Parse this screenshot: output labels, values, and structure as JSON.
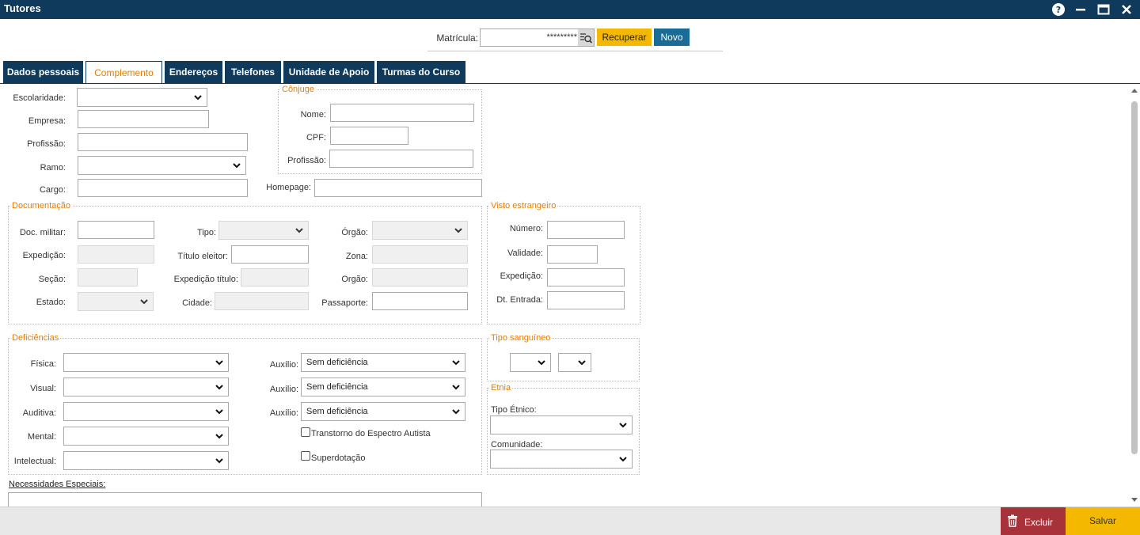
{
  "window": {
    "title": "Tutores"
  },
  "header": {
    "matricula_label": "Matrícula:",
    "matricula_value": "*********",
    "recuperar_label": "Recuperar",
    "novo_label": "Novo"
  },
  "tabs": [
    "Dados pessoais",
    "Complemento",
    "Endereços",
    "Telefones",
    "Unidade de Apoio",
    "Turmas do Curso"
  ],
  "active_tab": "Complemento",
  "form": {
    "escolaridade": "Escolaridade:",
    "empresa": "Empresa:",
    "profissao": "Profissão:",
    "ramo": "Ramo:",
    "cargo": "Cargo:",
    "homepage": "Homepage:"
  },
  "conjuge": {
    "legend": "Cônjuge",
    "nome": "Nome:",
    "cpf": "CPF:",
    "profissao": "Profissão:"
  },
  "documentacao": {
    "legend": "Documentação",
    "doc_militar": "Doc. militar:",
    "expedicao": "Expedição:",
    "secao": "Seção:",
    "estado": "Estado:",
    "tipo": "Tipo:",
    "titulo_eleitor": "Título eleitor:",
    "expedicao_titulo": "Expedição título:",
    "cidade": "Cidade:",
    "orgao": "Órgão:",
    "zona": "Zona:",
    "orgao2": "Orgão:",
    "passaporte": "Passaporte:"
  },
  "visto": {
    "legend": "Visto estrangeiro",
    "numero": "Número:",
    "validade": "Validade:",
    "expedicao": "Expedição:",
    "dt_entrada": "Dt. Entrada:"
  },
  "deficiencias": {
    "legend": "Deficiências",
    "fisica": "Física:",
    "visual": "Visual:",
    "auditiva": "Auditiva:",
    "mental": "Mental:",
    "intelectual": "Intelectual:",
    "auxilio": "Auxílio:",
    "auxilio_value": "Sem deficiência",
    "tea": "Transtorno do Espectro Autista",
    "superdotacao": "Superdotação"
  },
  "tipo_sanguineo": {
    "legend": "Tipo sanguíneo"
  },
  "etnia": {
    "legend": "Etnia",
    "tipo_etnico": "Tipo Étnico:",
    "comunidade": "Comunidade:"
  },
  "necessidades": {
    "label": "Necessidades Especiais:"
  },
  "footer": {
    "excluir_label": "Excluir",
    "salvar_label": "Salvar"
  },
  "icons": [
    "help-icon",
    "minimize-icon",
    "maximize-icon",
    "close-icon",
    "search-list-icon",
    "trash-icon",
    "chevron-down-icon",
    "scroll-up-icon",
    "scroll-down-icon"
  ],
  "colors": {
    "titlebar": "#0f3a5c",
    "accent": "#e67e00",
    "recuperar": "#f5b800",
    "novo": "#1a6b96",
    "excluir": "#a8323a",
    "salvar": "#f5b800"
  }
}
